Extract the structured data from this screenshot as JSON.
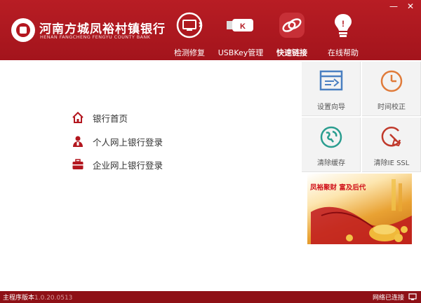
{
  "window": {
    "minimize": "—",
    "close": "✕"
  },
  "brand": {
    "name_cn": "河南方城凤裕村镇银行",
    "name_en": "HENAN FANGCHENG FENGYU COUNTY BANK",
    "logo_tag": "IT"
  },
  "nav": {
    "items": [
      {
        "label": "检测修复",
        "icon": "monitor-repair-icon"
      },
      {
        "label": "USBKey管理",
        "icon": "usbkey-icon",
        "key_letter": "K"
      },
      {
        "label": "快速链接",
        "icon": "quick-link-icon",
        "active": true
      },
      {
        "label": "在线帮助",
        "icon": "lightbulb-icon"
      }
    ]
  },
  "tiles": [
    {
      "label": "设置向导",
      "icon": "setup-wizard-icon"
    },
    {
      "label": "时间校正",
      "icon": "clock-icon"
    },
    {
      "label": "清除缓存",
      "icon": "clear-cache-icon"
    },
    {
      "label": "清除IE SSL",
      "icon": "clear-ssl-icon"
    }
  ],
  "links": [
    {
      "label": "银行首页",
      "icon": "home-icon"
    },
    {
      "label": "个人网上银行登录",
      "icon": "person-icon"
    },
    {
      "label": "企业网上银行登录",
      "icon": "briefcase-icon"
    }
  ],
  "promo": {
    "text": "凤裕聚财  富及后代"
  },
  "footer": {
    "version_label": "主程序版本",
    "version_number": "1.0.20.0513",
    "network_status": "网络已连接"
  },
  "colors": {
    "header_red": "#b3171f",
    "footer_red": "#8e1016",
    "tile_bg": "#f3f3f3",
    "orange": "#e07b3a",
    "teal": "#2a9d8f"
  }
}
